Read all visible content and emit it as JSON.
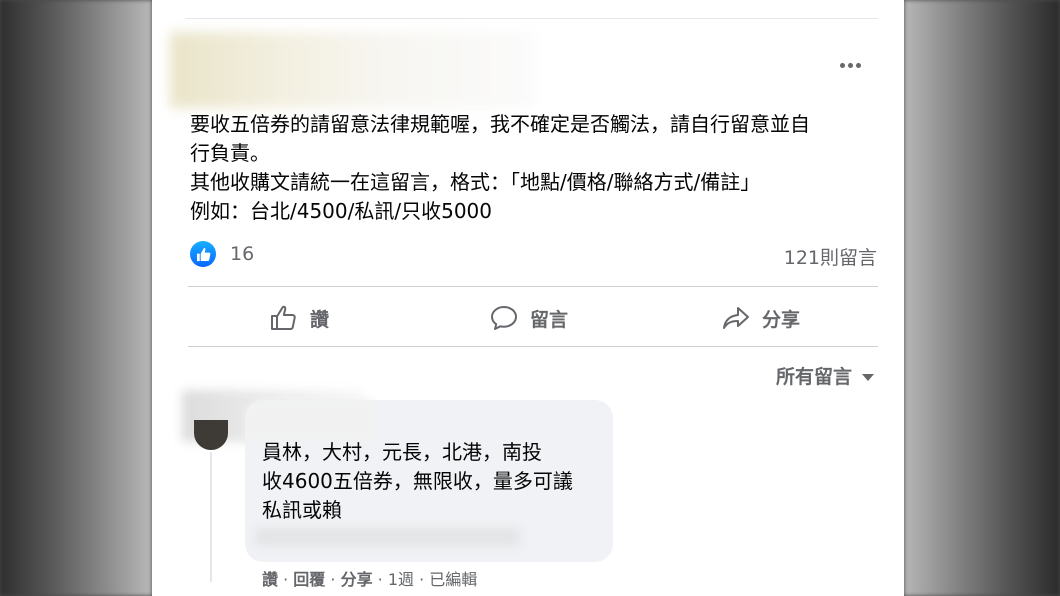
{
  "post": {
    "text_lines": [
      "要收五倍券的請留意法律規範喔，我不確定是否觸法，請自行留意並自",
      "行負責。",
      "其他收購文請統一在這留言，格式：「地點/價格/聯絡方式/備註」",
      "例如：台北/4500/私訊/只收5000"
    ],
    "reaction_count": "16",
    "comment_count": "121則留言"
  },
  "actions": {
    "like": "讚",
    "comment": "留言",
    "share": "分享"
  },
  "sort": {
    "label": "所有留言"
  },
  "comment": {
    "text_lines": [
      "員林，大村，元長，北港，南投",
      "收4600五倍券，無限收，量多可議",
      "私訊或賴"
    ],
    "meta": {
      "like": "讚",
      "sep": " · ",
      "reply": "回覆",
      "share": "分享",
      "time": "1週",
      "edited": "已編輯"
    }
  },
  "colors": {
    "like_blue": "#0866ff",
    "secondary_text": "#65676b",
    "bubble_bg": "#f0f2f5"
  },
  "icons": [
    "more-icon",
    "like-reaction-icon",
    "thumbs-up-icon",
    "comment-icon",
    "share-icon",
    "caret-down-icon"
  ]
}
